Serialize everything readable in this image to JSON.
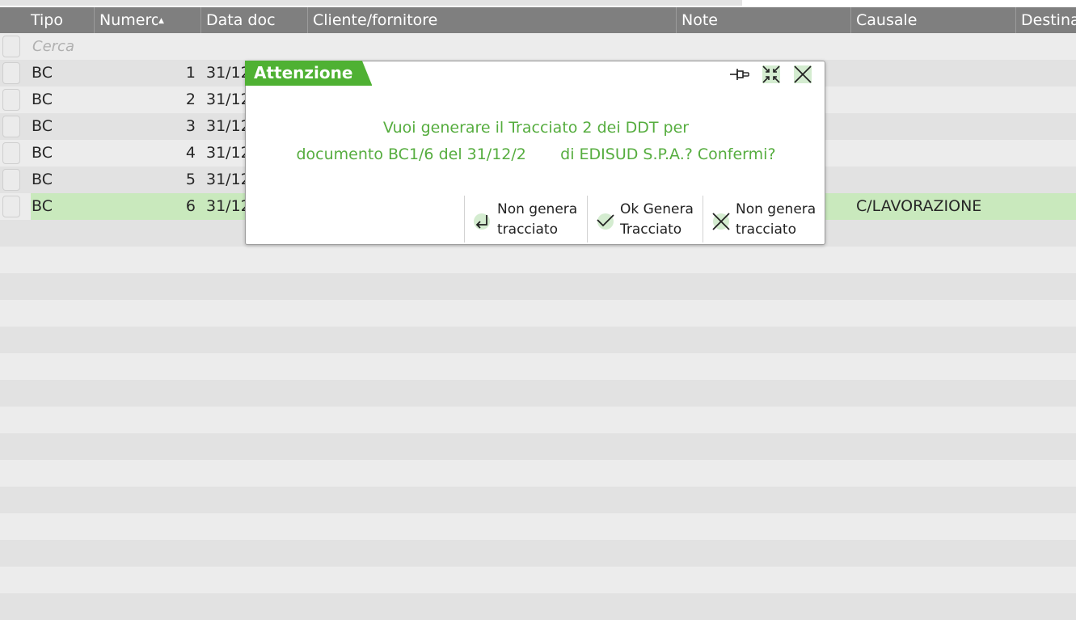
{
  "grid": {
    "columns": [
      {
        "label": "Tipo"
      },
      {
        "label": "Numero"
      },
      {
        "label": "Data doc"
      },
      {
        "label": "Cliente/fornitore"
      },
      {
        "label": "Note"
      },
      {
        "label": "Causale"
      },
      {
        "label": "Destina"
      }
    ],
    "search_placeholder": "Cerca",
    "rows": [
      {
        "tipo": "BC",
        "numero": "1",
        "data": "31/12",
        "causale": ""
      },
      {
        "tipo": "BC",
        "numero": "2",
        "data": "31/12",
        "causale": ""
      },
      {
        "tipo": "BC",
        "numero": "3",
        "data": "31/12",
        "causale": ""
      },
      {
        "tipo": "BC",
        "numero": "4",
        "data": "31/12",
        "causale": ""
      },
      {
        "tipo": "BC",
        "numero": "5",
        "data": "31/12",
        "causale": ""
      },
      {
        "tipo": "BC",
        "numero": "6",
        "data": "31/12",
        "causale": "C/LAVORAZIONE"
      }
    ]
  },
  "dialog": {
    "title": "Attenzione",
    "message_line1": "Vuoi generare il Tracciato 2 dei DDT per",
    "message_line2": "documento BC1/6 del 31/12/2       di EDISUD S.P.A.? Confermi?",
    "buttons": [
      {
        "label": "Non genera\ntracciato",
        "icon": "return-icon"
      },
      {
        "label": "Ok Genera\nTracciato",
        "icon": "check-icon"
      },
      {
        "label": "Non genera\ntracciato",
        "icon": "close-icon"
      }
    ]
  },
  "colors": {
    "accent": "#4fb133",
    "message": "#56ad3f",
    "header": "#7f7f7f",
    "selected_row": "#c9e9bd"
  }
}
